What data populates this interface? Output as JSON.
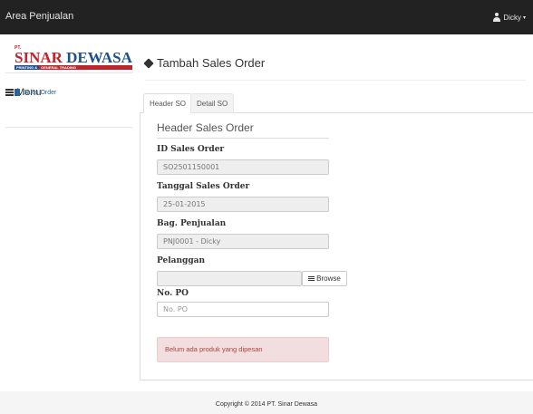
{
  "navbar": {
    "brand": "Area Penjualan",
    "user": "Dicky"
  },
  "logo": {
    "pt": "PT.",
    "word1": "SINAR",
    "word2": "DEWASA",
    "sub1": "PRINTING &",
    "sub2": "GENERAL TRADING"
  },
  "sidebar": {
    "menu_title": "Menu",
    "items": [
      {
        "label": "Sales Order",
        "icon": "file-icon"
      }
    ]
  },
  "page": {
    "title": "Tambah Sales Order"
  },
  "tabs": [
    {
      "label": "Header SO",
      "active": true
    },
    {
      "label": "Detail SO",
      "active": false
    }
  ],
  "form": {
    "section_title": "Header Sales Order",
    "id_label": "ID Sales Order",
    "id_value": "SO2501150001",
    "date_label": "Tanggal Sales Order",
    "date_value": "25-01-2015",
    "bag_label": "Bag. Penjualan",
    "bag_value": "PNJ0001 - Dicky",
    "pelanggan_label": "Pelanggan",
    "pelanggan_value": "",
    "browse_label": "Browse",
    "po_label": "No. PO",
    "po_placeholder": "No. PO",
    "alert_text": "Belum ada produk yang dipesan"
  },
  "footer": {
    "text": "Copyright © 2014 PT. Sinar Dewasa"
  },
  "colors": {
    "navbar_bg": "#222222",
    "link": "#2a6496",
    "alert_bg": "#f2dede",
    "alert_text": "#a94442",
    "logo_red": "#c0242a",
    "logo_blue": "#1f4f8f"
  }
}
